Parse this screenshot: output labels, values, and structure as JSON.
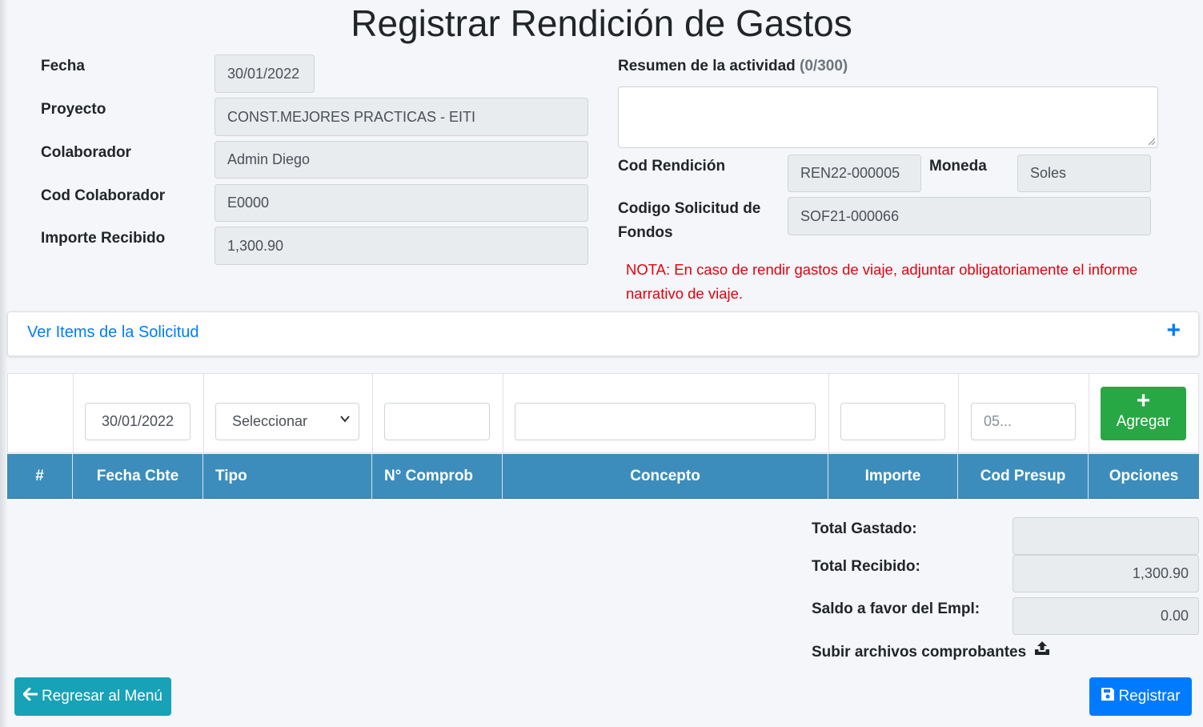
{
  "page": {
    "title": "Registrar Rendición de Gastos"
  },
  "form": {
    "fecha": {
      "label": "Fecha",
      "value": "30/01/2022"
    },
    "proyecto": {
      "label": "Proyecto",
      "value": "CONST.MEJORES PRACTICAS - EITI"
    },
    "colaborador": {
      "label": "Colaborador",
      "value": "Admin Diego"
    },
    "cod_colaborador": {
      "label": "Cod Colaborador",
      "value": "E0000"
    },
    "importe_recibido": {
      "label": "Importe Recibido",
      "value": "1,300.90"
    },
    "resumen": {
      "label": "Resumen de la actividad",
      "counter": "(0/300)",
      "value": ""
    },
    "cod_rendicion": {
      "label": "Cod Rendición",
      "value": "REN22-000005"
    },
    "moneda": {
      "label": "Moneda",
      "value": "Soles"
    },
    "codigo_solicitud": {
      "label_line1": "Codigo Solicitud de",
      "label_line2": "Fondos",
      "value": "SOF21-000066"
    },
    "nota_line1": "NOTA: En caso de rendir gastos de viaje, adjuntar obligatoriamente el informe",
    "nota_line2": "narrativo de viaje."
  },
  "collapse": {
    "label": "Ver Items de la Solicitud",
    "icon": "plus-icon"
  },
  "entry_row": {
    "fecha": "30/01/2022",
    "tipo_selected": "Seleccionar",
    "comprob": "",
    "concepto": "",
    "importe": "",
    "cod_presup_placeholder": "05...",
    "add_label": "Agregar"
  },
  "table": {
    "headers": [
      "#",
      "Fecha Cbte",
      "Tipo",
      "N° Comprob",
      "Concepto",
      "Importe",
      "Cod Presup",
      "Opciones"
    ],
    "header_color": "#3c8dbc"
  },
  "totals": {
    "gastado": {
      "label": "Total Gastado:",
      "value": ""
    },
    "recibido": {
      "label": "Total Recibido:",
      "value": "1,300.90"
    },
    "saldo": {
      "label": "Saldo a favor del Empl:",
      "value": "0.00"
    },
    "upload_label": "Subir archivos comprobantes"
  },
  "buttons": {
    "back": {
      "label": "Regresar al Menú",
      "color": "#17a2b8",
      "icon": "arrow-left-icon"
    },
    "register": {
      "label": "Registrar",
      "color": "#007bff",
      "icon": "save-icon"
    }
  },
  "colors": {
    "nota": "#e3000f",
    "link": "#007bff",
    "add": "#28a745"
  }
}
